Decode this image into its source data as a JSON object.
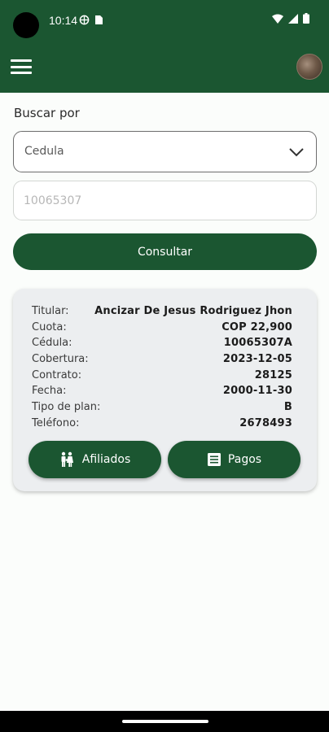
{
  "status_bar": {
    "time": "10:14"
  },
  "header": {
    "menu_icon": "hamburger-menu-icon",
    "avatar": "user-avatar"
  },
  "search": {
    "label": "Buscar por",
    "select_value": "Cedula",
    "input_placeholder": "10065307",
    "input_value": "",
    "button_label": "Consultar"
  },
  "result": {
    "rows": [
      {
        "label": "Titular:",
        "value": "Ancizar De  Jesus Rodriguez Jhon"
      },
      {
        "label": "Cuota:",
        "value": "COP 22,900"
      },
      {
        "label": "Cédula:",
        "value": "10065307A"
      },
      {
        "label": "Cobertura:",
        "value": "2023-12-05"
      },
      {
        "label": "Contrato:",
        "value": "28125"
      },
      {
        "label": "Fecha:",
        "value": "2000-11-30"
      },
      {
        "label": "Tipo de plan:",
        "value": "B"
      },
      {
        "label": "Teléfono:",
        "value": "2678493"
      }
    ],
    "afiliados_label": "Afiliados",
    "pagos_label": "Pagos"
  },
  "colors": {
    "primary": "#1b5631",
    "card_bg": "#eceef0",
    "background": "#fbfdfb"
  }
}
